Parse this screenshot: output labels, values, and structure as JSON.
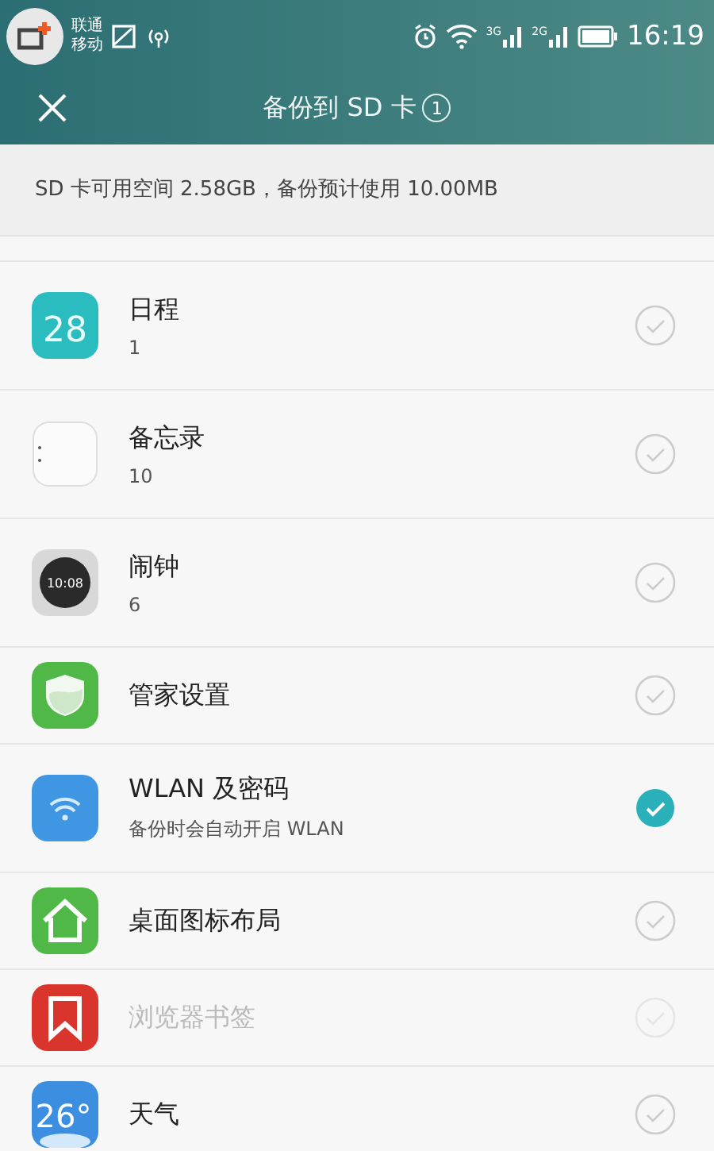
{
  "status_bar": {
    "carriers": [
      "联通",
      "移动"
    ],
    "network_labels": [
      "3G",
      "2G"
    ],
    "time": "16:19"
  },
  "header": {
    "title": "备份到 SD 卡",
    "badge": "1"
  },
  "info": "SD 卡可用空间 2.58GB，备份预计使用 10.00MB",
  "items": [
    {
      "name": "日程",
      "detail": "1",
      "kind": "calendar",
      "icon_text": "28",
      "checked": false,
      "disabled": false
    },
    {
      "name": "备忘录",
      "detail": "10",
      "kind": "notes",
      "checked": false,
      "disabled": false
    },
    {
      "name": "闹钟",
      "detail": "6",
      "kind": "clock",
      "icon_text": "10:08",
      "checked": false,
      "disabled": false
    },
    {
      "name": "管家设置",
      "kind": "shield",
      "checked": false,
      "disabled": false
    },
    {
      "name": "WLAN 及密码",
      "detail": "备份时会自动开启 WLAN",
      "kind": "wifi",
      "checked": true,
      "disabled": false
    },
    {
      "name": "桌面图标布局",
      "kind": "home",
      "checked": false,
      "disabled": false
    },
    {
      "name": "浏览器书签",
      "kind": "bookmark",
      "checked": false,
      "disabled": true
    },
    {
      "name": "天气",
      "kind": "weather",
      "icon_text": "26°",
      "checked": false,
      "disabled": false
    }
  ]
}
